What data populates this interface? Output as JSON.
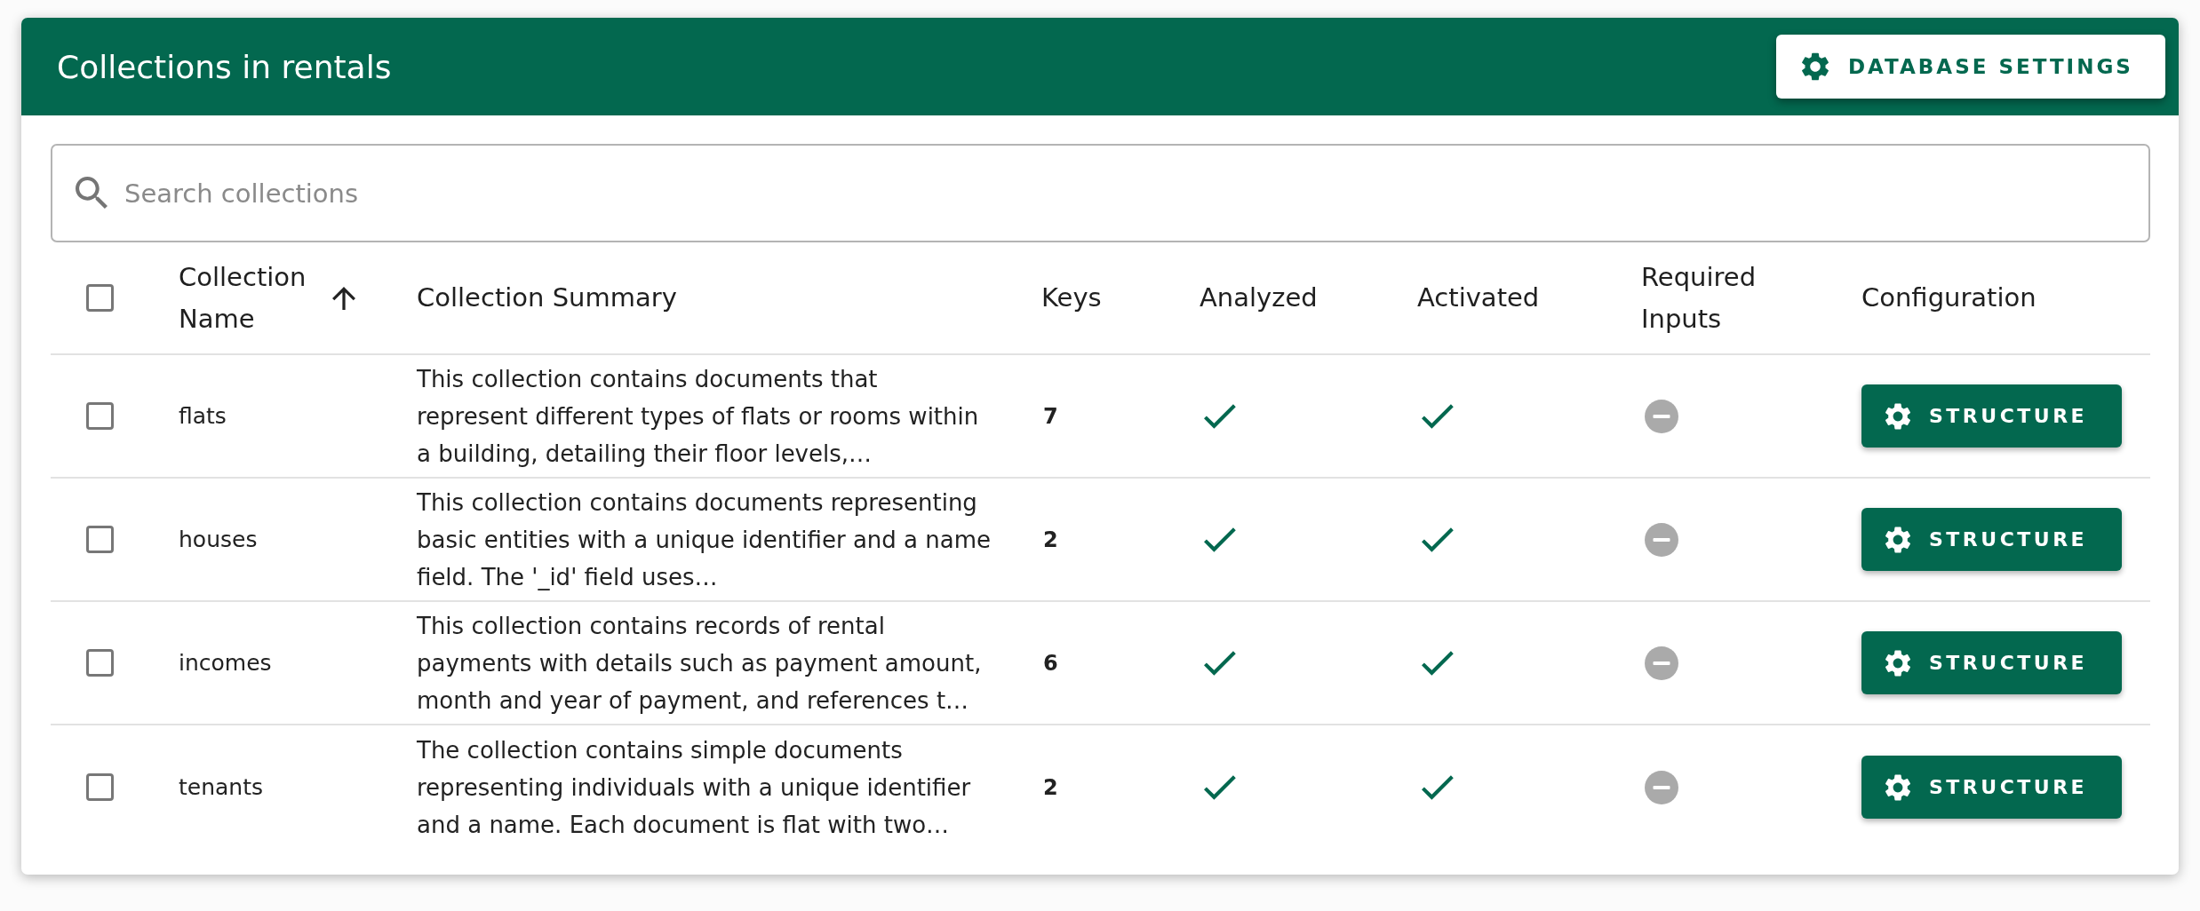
{
  "header": {
    "title": "Collections in rentals",
    "settings_button": "DATABASE SETTINGS"
  },
  "search": {
    "placeholder": "Search collections"
  },
  "table": {
    "select_all": {
      "checked": false
    },
    "columns": [
      {
        "label": "Collection Name",
        "sorted": true
      },
      {
        "label": "Collection Summary",
        "sorted": false
      },
      {
        "label": "Keys",
        "sorted": false
      },
      {
        "label": "Analyzed",
        "sorted": false
      },
      {
        "label": "Activated",
        "sorted": false
      },
      {
        "label": "Required Inputs",
        "sorted": false
      },
      {
        "label": "Configuration",
        "sorted": false
      }
    ],
    "rows": [
      {
        "checked": false,
        "name": "flats",
        "summary": "This collection contains documents that represent different types of flats or rooms within a building, detailing their floor levels,…",
        "keys": "7",
        "analyzed": true,
        "activated": true,
        "required_inputs": false,
        "configure_button": "STRUCTURE"
      },
      {
        "checked": false,
        "name": "houses",
        "summary": "This collection contains documents representing basic entities with a unique identifier and a name field. The '_id' field uses…",
        "keys": "2",
        "analyzed": true,
        "activated": true,
        "required_inputs": false,
        "configure_button": "STRUCTURE"
      },
      {
        "checked": false,
        "name": "incomes",
        "summary": "This collection contains records of rental payments with details such as payment amount, month and year of payment, and references t…",
        "keys": "6",
        "analyzed": true,
        "activated": true,
        "required_inputs": false,
        "configure_button": "STRUCTURE"
      },
      {
        "checked": false,
        "name": "tenants",
        "summary": "The collection contains simple documents representing individuals with a unique identifier and a name. Each document is flat with two…",
        "keys": "2",
        "analyzed": true,
        "activated": true,
        "required_inputs": false,
        "configure_button": "STRUCTURE"
      }
    ]
  }
}
